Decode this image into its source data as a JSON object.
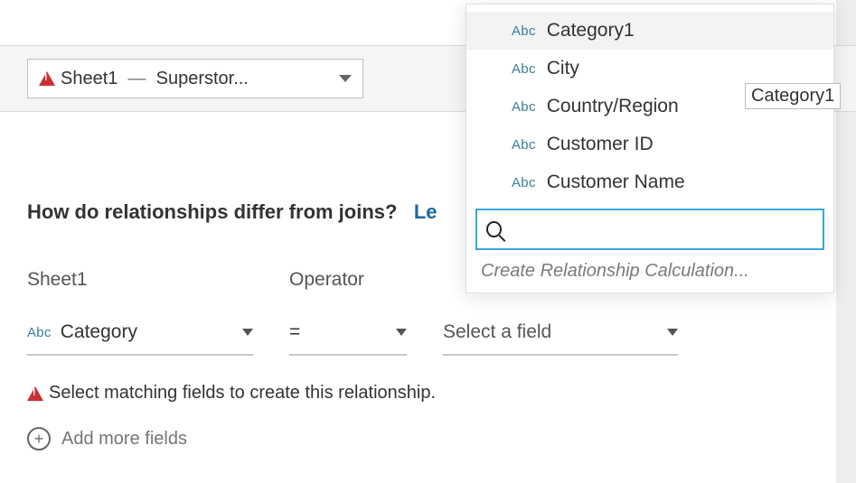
{
  "toolbar": {
    "sheet_label": "Sheet1",
    "sep": "  —  ",
    "source_label": "Superstor..."
  },
  "help": {
    "question": "How do relationships differ from joins?",
    "learn_partial": "Le"
  },
  "columns": {
    "left": {
      "title": "Sheet1",
      "field_type": "Abc",
      "field": "Category"
    },
    "op": {
      "title": "Operator",
      "value": "="
    },
    "right": {
      "placeholder": "Select a field"
    }
  },
  "warning_text": "Select matching fields to create this relationship.",
  "add_more": "Add more fields",
  "dropdown": {
    "items": [
      {
        "type": "Abc",
        "label": "Category1",
        "hl": true
      },
      {
        "type": "Abc",
        "label": "City"
      },
      {
        "type": "Abc",
        "label": "Country/Region"
      },
      {
        "type": "Abc",
        "label": "Customer ID"
      },
      {
        "type": "Abc",
        "label": "Customer Name"
      }
    ],
    "calc_label": "Create Relationship Calculation...",
    "search_value": ""
  },
  "tooltip": "Category1"
}
